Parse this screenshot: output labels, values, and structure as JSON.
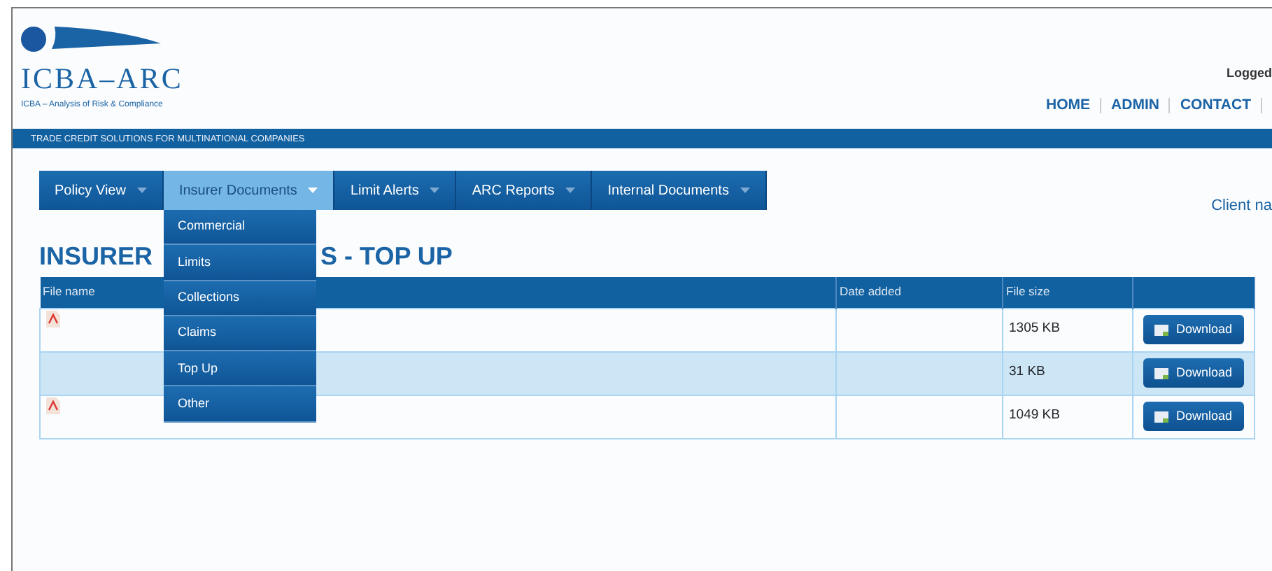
{
  "logo": {
    "name": "ICBA–ARC",
    "tagline": "ICBA – Analysis of Risk & Compliance"
  },
  "user": {
    "logged": "Logged"
  },
  "top_links": [
    {
      "label": "HOME"
    },
    {
      "label": "ADMIN"
    },
    {
      "label": "CONTACT"
    }
  ],
  "banner": "TRADE CREDIT SOLUTIONS FOR MULTINATIONAL COMPANIES",
  "menu": [
    {
      "label": "Policy View",
      "selected": false
    },
    {
      "label": "Insurer Documents",
      "selected": true,
      "expanded": true,
      "items": [
        "Commercial",
        "Limits",
        "Collections",
        "Claims",
        "Top Up",
        "Other"
      ]
    },
    {
      "label": "Limit Alerts",
      "selected": false
    },
    {
      "label": "ARC Reports",
      "selected": false
    },
    {
      "label": "Internal Documents",
      "selected": false
    }
  ],
  "client": "Client na",
  "heading": [
    "INSURER",
    "S - TOP UP"
  ],
  "table": {
    "columns": [
      "File name",
      "Date added",
      "File size",
      ""
    ],
    "rows": [
      {
        "pdf": true,
        "size": "1305 KB",
        "action": "Download",
        "selected": false
      },
      {
        "pdf": false,
        "size": "31 KB",
        "action": "Download",
        "selected": true
      },
      {
        "pdf": true,
        "size": "1049 KB",
        "action": "Download",
        "selected": false
      }
    ]
  }
}
